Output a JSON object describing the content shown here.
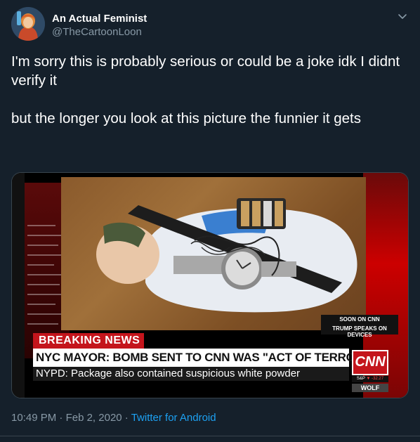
{
  "tweet": {
    "display_name": "An Actual Feminist",
    "handle": "@TheCartoonLoon",
    "text": "I'm sorry this is probably serious or could be a joke idk I didnt verify it\n\nbut the longer you look at this picture the funnier it gets",
    "time": "10:49 PM",
    "date": "Feb 2, 2020",
    "separator": "·",
    "source": "Twitter for Android",
    "icons": {
      "avatar": "avatar-cartoon-woman",
      "menu": "chevron-down-icon"
    }
  },
  "media": {
    "soon_label": "SOON ON CNN",
    "soon_sub": "TRUMP SPEAKS ON DEVICES",
    "breaking_label": "BREAKING NEWS",
    "headline": "NYC MAYOR: BOMB SENT TO CNN WAS \"ACT OF TERROR\"",
    "subheadline": "NYPD: Package also contained suspicious white powder",
    "logo": "CNN",
    "ticker_symbol": "S&P",
    "ticker_value": "▼ -32.27",
    "show_name": "WOLF"
  },
  "colors": {
    "background": "#15202b",
    "secondary_text": "#8899a6",
    "link": "#1da1f2",
    "cnn_red": "#c4151c"
  }
}
